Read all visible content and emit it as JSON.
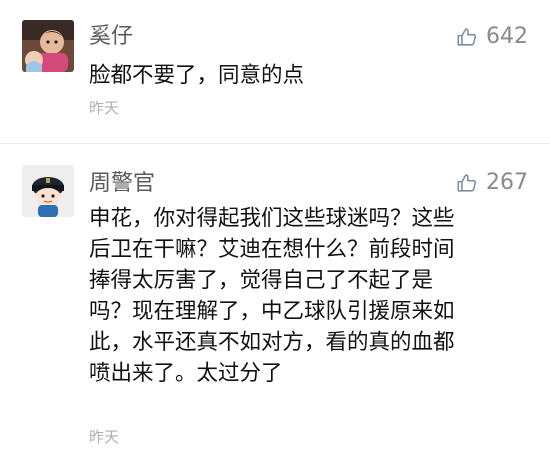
{
  "comments": [
    {
      "username": "奚仔",
      "likes": "642",
      "text": "脸都不要了，同意的点",
      "time": "昨天",
      "avatar_icon": "child-photo-avatar"
    },
    {
      "username": "周警官",
      "likes": "267",
      "text": "申花，你对得起我们这些球迷吗？这些\n后卫在干嘛？艾迪在想什么？前段时间\n捧得太厉害了，觉得自己了不起了是\n吗？现在理解了，中乙球队引援原来如\n此，水平还真不如对方，看的真的血都\n喷出来了。太过分了",
      "time": "昨天",
      "avatar_icon": "police-doll-avatar"
    }
  ],
  "colors": {
    "username": "#5a5a5a",
    "like": "#8a8a8a",
    "text": "#111111",
    "time": "#b0b0b0"
  }
}
